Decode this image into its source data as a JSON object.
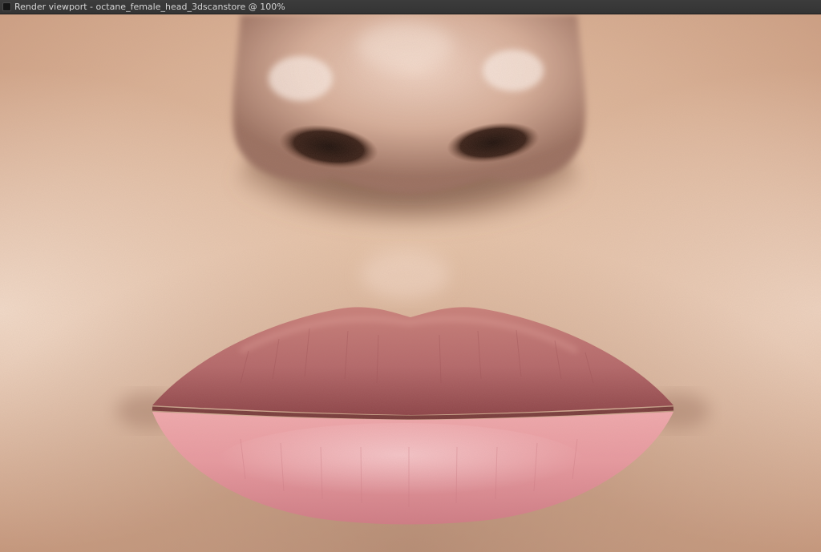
{
  "window": {
    "title": "Render viewport - octane_female_head_3dscanstore @ 100%",
    "icon": "window-icon"
  },
  "viewport": {
    "zoom_percent": 100,
    "image_subject": "render-image",
    "colors": {
      "skin": "#dcb49a",
      "skin_highlight": "#f2dccb",
      "nose_shadow": "#6e4a38",
      "upper_lip": "#b86f6c",
      "lower_lip": "#e49aa0",
      "lip_line": "#6a2a2e"
    }
  }
}
